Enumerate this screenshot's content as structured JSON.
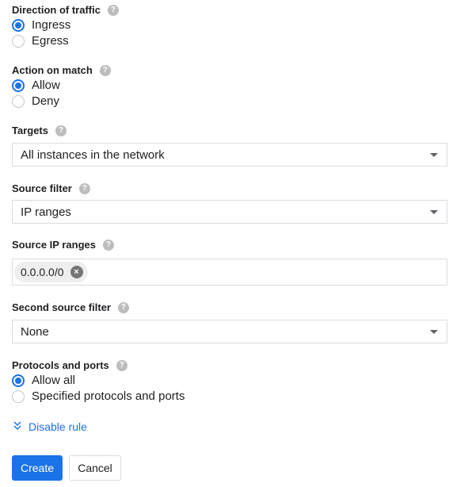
{
  "direction": {
    "label": "Direction of traffic",
    "help_icon": "?",
    "options": [
      {
        "label": "Ingress",
        "selected": true
      },
      {
        "label": "Egress",
        "selected": false
      }
    ]
  },
  "action": {
    "label": "Action on match",
    "help_icon": "?",
    "options": [
      {
        "label": "Allow",
        "selected": true
      },
      {
        "label": "Deny",
        "selected": false
      }
    ]
  },
  "targets": {
    "label": "Targets",
    "help_icon": "?",
    "value": "All instances in the network"
  },
  "source_filter": {
    "label": "Source filter",
    "help_icon": "?",
    "value": "IP ranges"
  },
  "source_ip_ranges": {
    "label": "Source IP ranges",
    "help_icon": "?",
    "chips": [
      "0.0.0.0/0"
    ],
    "chip_remove": "×"
  },
  "second_source_filter": {
    "label": "Second source filter",
    "help_icon": "?",
    "value": "None"
  },
  "protocols": {
    "label": "Protocols and ports",
    "help_icon": "?",
    "options": [
      {
        "label": "Allow all",
        "selected": true
      },
      {
        "label": "Specified protocols and ports",
        "selected": false
      }
    ]
  },
  "disable_rule": {
    "icon": "chevron-down-double",
    "label": "Disable rule"
  },
  "buttons": {
    "create": "Create",
    "cancel": "Cancel"
  },
  "colors": {
    "accent": "#1a73e8",
    "text": "#202124",
    "border": "#dadce0"
  }
}
